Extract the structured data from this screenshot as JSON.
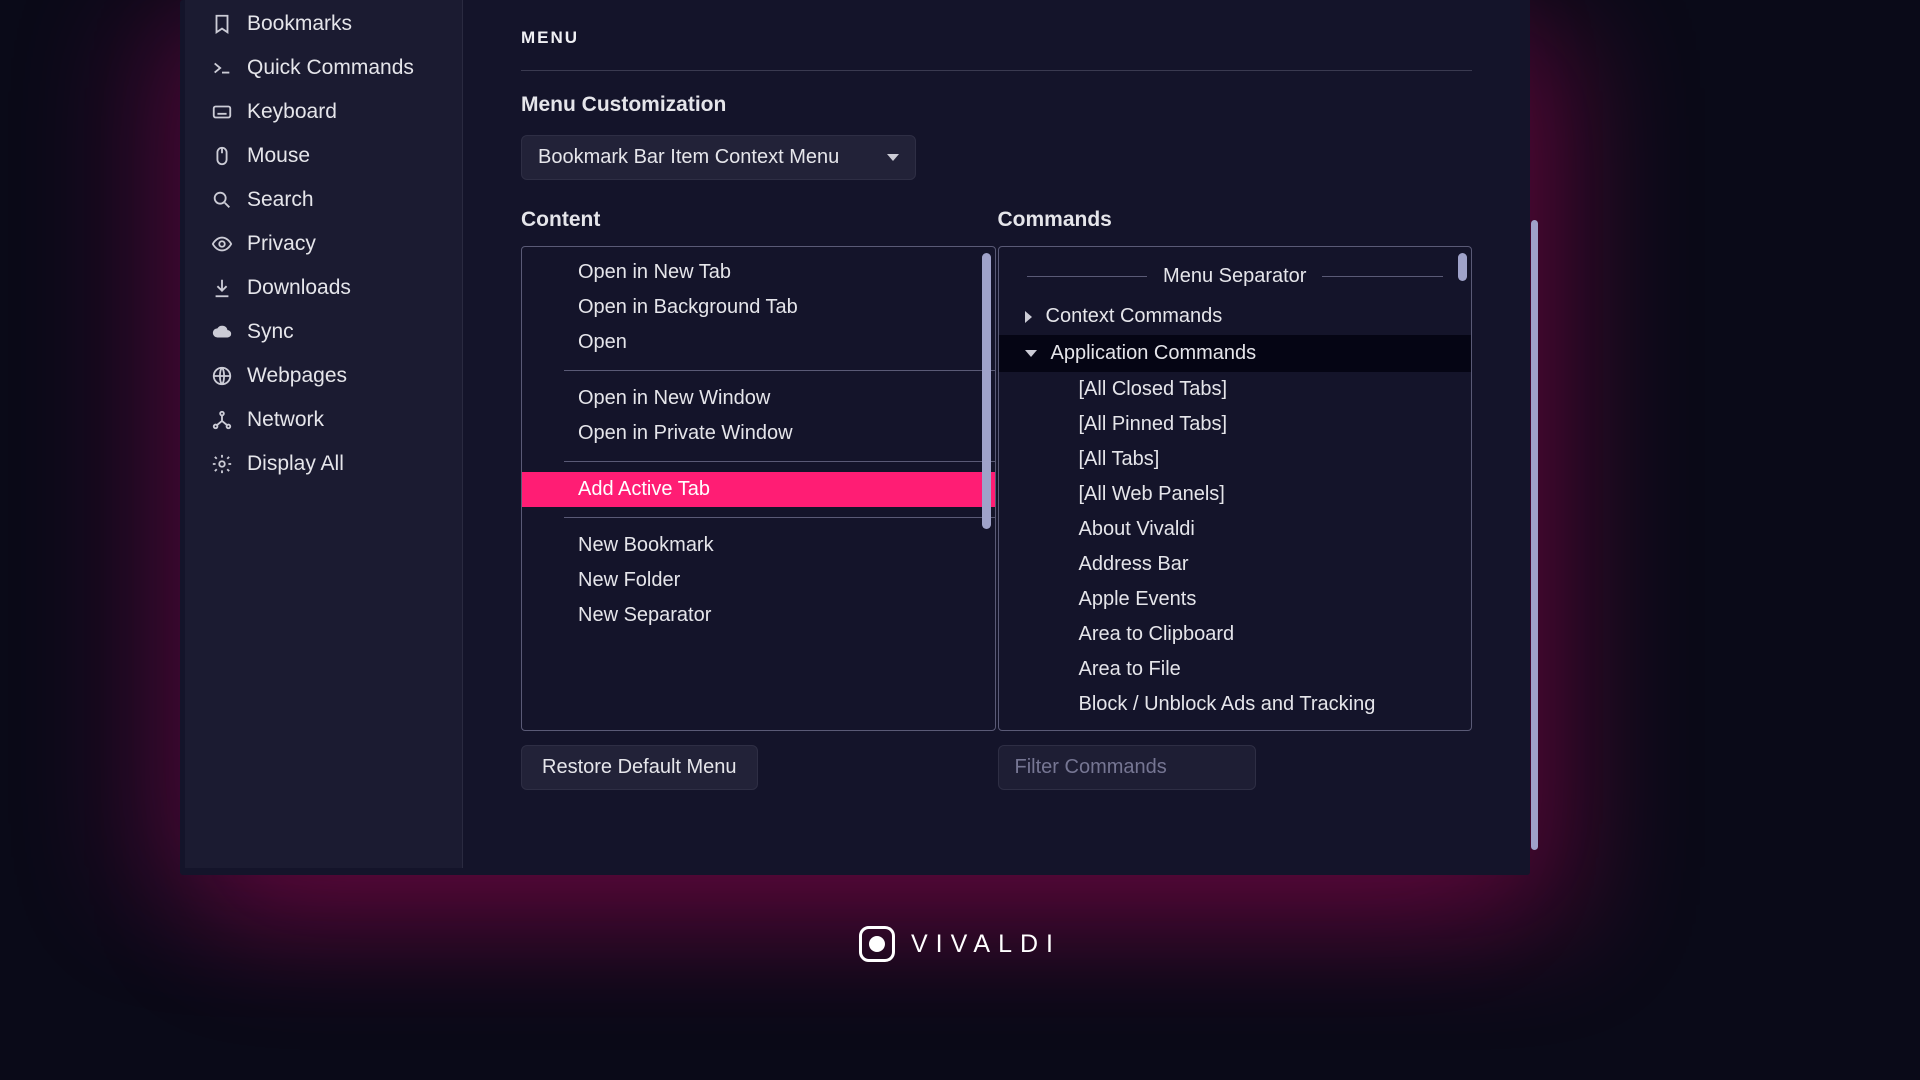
{
  "sidebar": {
    "items": [
      {
        "label": "Bookmarks",
        "icon": "bookmark-icon"
      },
      {
        "label": "Quick Commands",
        "icon": "prompt-icon"
      },
      {
        "label": "Keyboard",
        "icon": "keyboard-icon"
      },
      {
        "label": "Mouse",
        "icon": "mouse-icon"
      },
      {
        "label": "Search",
        "icon": "search-icon"
      },
      {
        "label": "Privacy",
        "icon": "eye-icon"
      },
      {
        "label": "Downloads",
        "icon": "download-icon"
      },
      {
        "label": "Sync",
        "icon": "cloud-icon"
      },
      {
        "label": "Webpages",
        "icon": "globe-icon"
      },
      {
        "label": "Network",
        "icon": "network-icon"
      },
      {
        "label": "Display All",
        "icon": "gear-icon"
      }
    ]
  },
  "main": {
    "section_title": "MENU",
    "subheading": "Menu Customization",
    "select_value": "Bookmark Bar Item Context Menu",
    "content_heading": "Content",
    "commands_heading": "Commands",
    "content_items": [
      {
        "type": "item",
        "label": "Open in New Tab"
      },
      {
        "type": "item",
        "label": "Open in Background Tab"
      },
      {
        "type": "item",
        "label": "Open"
      },
      {
        "type": "sep"
      },
      {
        "type": "item",
        "label": "Open in New Window"
      },
      {
        "type": "item",
        "label": "Open in Private Window"
      },
      {
        "type": "sep"
      },
      {
        "type": "item",
        "label": "Add Active Tab",
        "selected": true
      },
      {
        "type": "sep"
      },
      {
        "type": "item",
        "label": "New Bookmark"
      },
      {
        "type": "item",
        "label": "New Folder"
      },
      {
        "type": "item",
        "label": "New Separator"
      }
    ],
    "commands": {
      "separator_label": "Menu Separator",
      "groups": [
        {
          "label": "Context Commands",
          "expanded": false
        },
        {
          "label": "Application Commands",
          "expanded": true,
          "active": true
        }
      ],
      "children": [
        "[All Closed Tabs]",
        "[All Pinned Tabs]",
        "[All Tabs]",
        "[All Web Panels]",
        "About Vivaldi",
        "Address Bar",
        "Apple Events",
        "Area to Clipboard",
        "Area to File",
        "Block / Unblock Ads and Tracking"
      ]
    },
    "restore_button": "Restore Default Menu",
    "filter_placeholder": "Filter Commands"
  },
  "brand": "VIVALDI"
}
